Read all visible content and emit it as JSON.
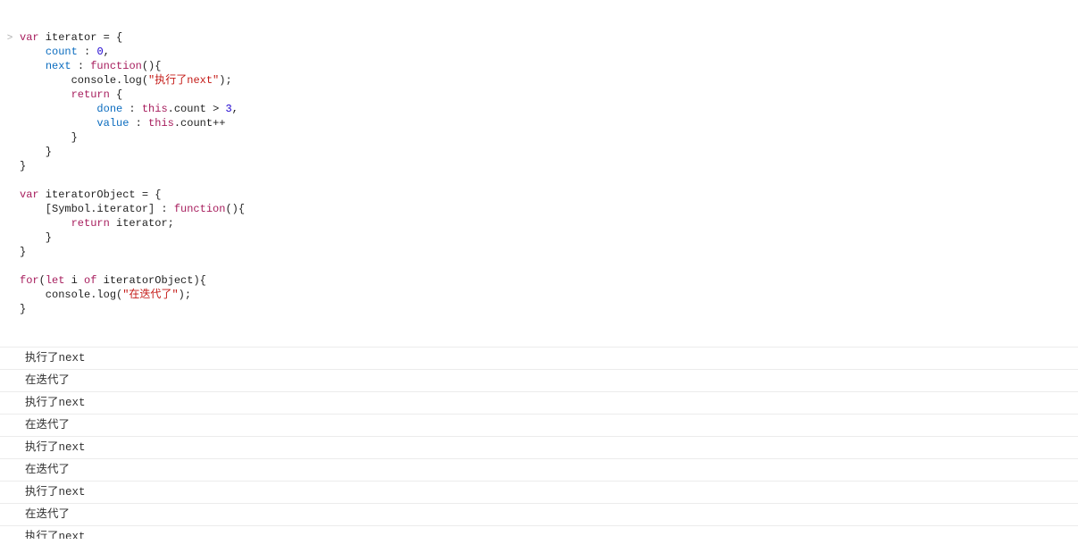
{
  "prompt_symbol": ">",
  "code": {
    "tokens": [
      [
        [
          "kw",
          "var"
        ],
        [
          "pln",
          " iterator "
        ],
        [
          "pln",
          "="
        ],
        [
          "pln",
          " {"
        ]
      ],
      [
        [
          "pln",
          "    "
        ],
        [
          "prop",
          "count"
        ],
        [
          "pln",
          " : "
        ],
        [
          "num",
          "0"
        ],
        [
          "pln",
          ","
        ]
      ],
      [
        [
          "pln",
          "    "
        ],
        [
          "prop",
          "next"
        ],
        [
          "pln",
          " : "
        ],
        [
          "kw",
          "function"
        ],
        [
          "pln",
          "(){"
        ]
      ],
      [
        [
          "pln",
          "        console.log("
        ],
        [
          "str",
          "\""
        ],
        [
          "strcn",
          "执行了"
        ],
        [
          "str",
          "next\""
        ],
        [
          "pln",
          ");"
        ]
      ],
      [
        [
          "pln",
          "        "
        ],
        [
          "kw",
          "return"
        ],
        [
          "pln",
          " {"
        ]
      ],
      [
        [
          "pln",
          "            "
        ],
        [
          "prop",
          "done"
        ],
        [
          "pln",
          " : "
        ],
        [
          "kw",
          "this"
        ],
        [
          "pln",
          ".count > "
        ],
        [
          "num",
          "3"
        ],
        [
          "pln",
          ","
        ]
      ],
      [
        [
          "pln",
          "            "
        ],
        [
          "prop",
          "value"
        ],
        [
          "pln",
          " : "
        ],
        [
          "kw",
          "this"
        ],
        [
          "pln",
          ".count"
        ],
        [
          "pln",
          "++"
        ]
      ],
      [
        [
          "pln",
          "        }"
        ]
      ],
      [
        [
          "pln",
          "    }"
        ]
      ],
      [
        [
          "pln",
          "}"
        ]
      ],
      [
        [
          "pln",
          ""
        ]
      ],
      [
        [
          "kw",
          "var"
        ],
        [
          "pln",
          " iteratorObject "
        ],
        [
          "pln",
          "="
        ],
        [
          "pln",
          " {"
        ]
      ],
      [
        [
          "pln",
          "    [Symbol.iterator] : "
        ],
        [
          "kw",
          "function"
        ],
        [
          "pln",
          "(){"
        ]
      ],
      [
        [
          "pln",
          "        "
        ],
        [
          "kw",
          "return"
        ],
        [
          "pln",
          " iterator;"
        ]
      ],
      [
        [
          "pln",
          "    }"
        ]
      ],
      [
        [
          "pln",
          "}"
        ]
      ],
      [
        [
          "pln",
          ""
        ]
      ],
      [
        [
          "kw",
          "for"
        ],
        [
          "pln",
          "("
        ],
        [
          "kw",
          "let"
        ],
        [
          "pln",
          " i "
        ],
        [
          "kw",
          "of"
        ],
        [
          "pln",
          " iteratorObject){"
        ]
      ],
      [
        [
          "pln",
          "    console.log("
        ],
        [
          "str",
          "\""
        ],
        [
          "strcn",
          "在迭代了"
        ],
        [
          "str",
          "\""
        ],
        [
          "pln",
          ");"
        ]
      ],
      [
        [
          "pln",
          "}"
        ]
      ]
    ]
  },
  "logs": [
    "执行了next",
    "在迭代了",
    "执行了next",
    "在迭代了",
    "执行了next",
    "在迭代了",
    "执行了next",
    "在迭代了",
    "执行了next"
  ],
  "last_log_cut": true
}
